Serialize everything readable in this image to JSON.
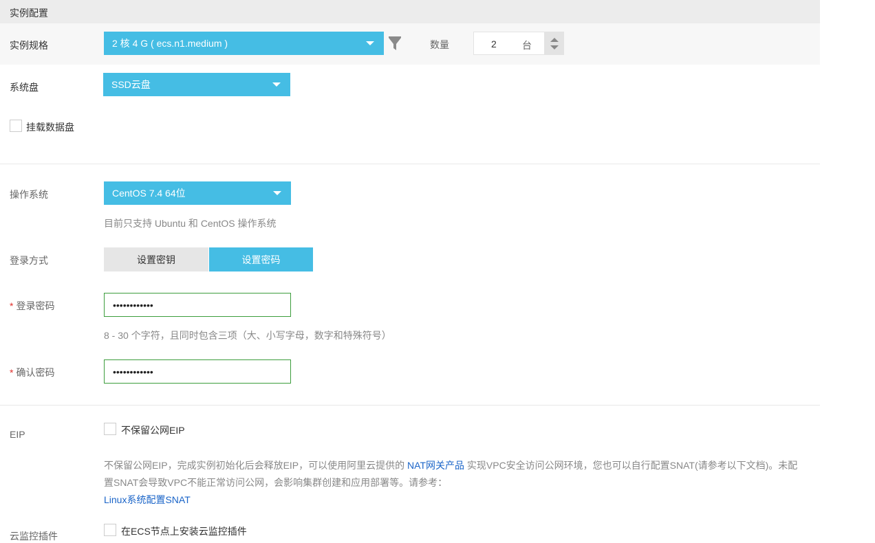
{
  "section": {
    "title": "实例配置"
  },
  "spec": {
    "label": "实例规格",
    "value": "2 核 4 G ( ecs.n1.medium )",
    "filter_icon": "filter-icon",
    "qty_label": "数量",
    "qty_value": "2",
    "qty_unit": "台"
  },
  "disk": {
    "label": "系统盘",
    "value": "SSD云盘"
  },
  "data_disk": {
    "label": "挂载数据盘",
    "checked": false
  },
  "os": {
    "label": "操作系统",
    "value": "CentOS 7.4 64位",
    "hint": "目前只支持 Ubuntu 和 CentOS 操作系统"
  },
  "login": {
    "label": "登录方式",
    "options": [
      "设置密钥",
      "设置密码"
    ],
    "selected": "设置密码"
  },
  "password": {
    "required_mark": "*",
    "label": "登录密码",
    "value": "••••••••••••",
    "hint": "8 - 30 个字符，且同时包含三项（大、小写字母，数字和特殊符号）"
  },
  "confirm": {
    "required_mark": "*",
    "label": "确认密码",
    "value": "••••••••••••"
  },
  "eip": {
    "label": "EIP",
    "checkbox_label": "不保留公网EIP",
    "checked": false,
    "note_part1": "不保留公网EIP，完成实例初始化后会释放EIP，可以使用阿里云提供的 ",
    "note_link": "NAT网关产品",
    "note_part2": " 实现VPC安全访问公网环境，您也可以自行配置SNAT(请参考以下文档)。未配置SNAT会导致VPC不能正常访问公网，会影响集群创建和应用部署等。请参考：",
    "doc_link": "Linux系统配置SNAT"
  },
  "monitor": {
    "label": "云监控插件",
    "checkbox_label": "在ECS节点上安装云监控插件",
    "checked": false
  },
  "colors": {
    "accent": "#45bde4",
    "link": "#1a64c8",
    "required": "#e0302c",
    "input_border": "#3b9c3b"
  }
}
